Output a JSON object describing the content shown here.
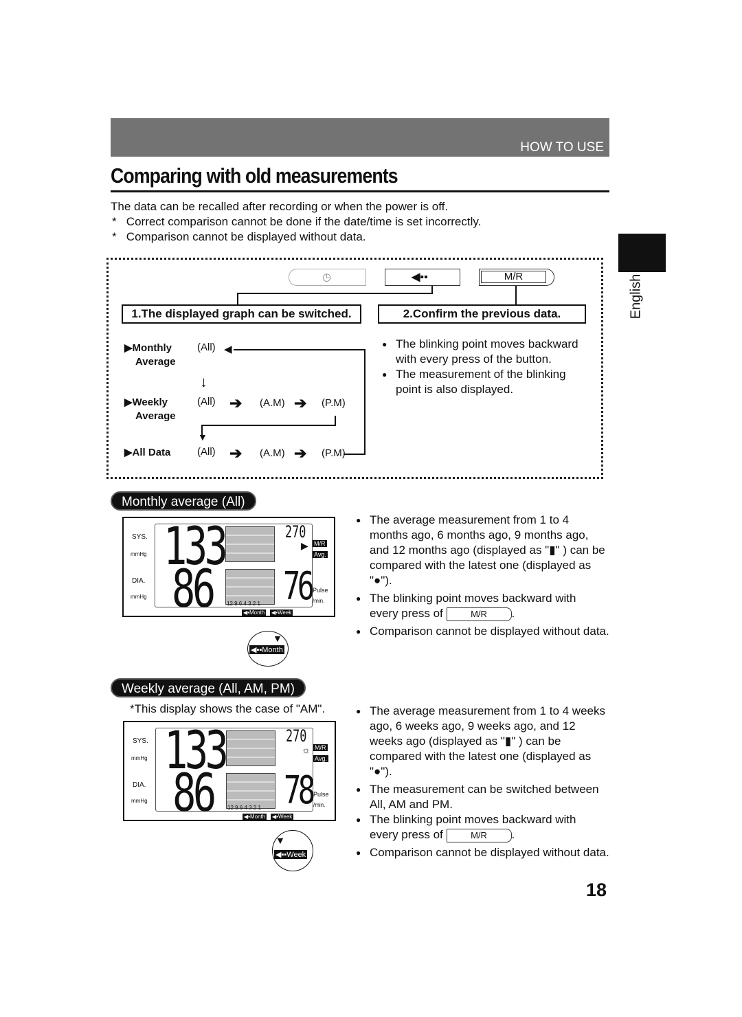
{
  "header": {
    "section": "HOW TO USE",
    "title": "Comparing with old measurements"
  },
  "intro": {
    "line": "The data can be recalled after recording or when the power is off.",
    "notes": [
      "Correct comparison cannot be done if the date/time is set incorrectly.",
      "Comparison cannot be displayed without data."
    ]
  },
  "side_tab": {
    "language": "English"
  },
  "diagram": {
    "buttons": {
      "mr": "M/R"
    },
    "box1": "1.The displayed graph can be switched.",
    "box2": "2.Confirm the previous data.",
    "rows": [
      {
        "label": "▶Monthly",
        "label2": "Average",
        "modes": [
          "(All)"
        ]
      },
      {
        "label": "▶Weekly",
        "label2": "Average",
        "modes": [
          "(All)",
          "(A.M)",
          "(P.M)"
        ]
      },
      {
        "label": "▶All Data",
        "label2": "",
        "modes": [
          "(All)",
          "(A.M)",
          "(P.M)"
        ]
      }
    ],
    "bullets": [
      "The blinking point moves backward with every press of the button.",
      "The measurement of the blinking point is also displayed."
    ]
  },
  "monthly": {
    "heading": "Monthly average (All)",
    "lcd": {
      "sys": "133",
      "dia": "86",
      "pulse": "76",
      "memory": "270",
      "sys_label": "SYS.",
      "dia_label": "DIA.",
      "unit": "mmHg",
      "pulse_label": "Pulse",
      "per_min": "/min.",
      "mr_tag": "M/R",
      "avg_tag": "Avg.",
      "axis": "12 9 6 4 3 2 1",
      "month_tag": "Month",
      "week_tag": "Week"
    },
    "zoom_label": "Month",
    "bullets": {
      "b1": "The average measurement from 1 to 4 months ago, 6 months ago, 9 months ago, and 12 months ago (displayed as \"▮\" ) can be compared with the latest one (displayed as \"●\").",
      "b2a": "The blinking point moves backward with",
      "b2b": "every press of",
      "b2c": ".",
      "b3": "Comparison cannot be displayed without data."
    }
  },
  "weekly": {
    "heading": "Weekly average (All, AM, PM)",
    "note": "*This display shows the case of \"AM\".",
    "lcd": {
      "sys": "133",
      "dia": "86",
      "pulse": "78",
      "memory": "270",
      "sys_label": "SYS.",
      "dia_label": "DIA.",
      "unit": "mmHg",
      "pulse_label": "Pulse",
      "per_min": "/min.",
      "mr_tag": "M/R",
      "avg_tag": "Avg.",
      "axis": "12 9 6 4 3 2 1",
      "month_tag": "Month",
      "week_tag": "Week"
    },
    "zoom_label": "Week",
    "bullets": {
      "b1": "The average measurement from 1 to 4 weeks ago, 6 weeks ago, 9 weeks ago, and 12 weeks ago (displayed as \"▮\" ) can be compared with the latest one (displayed as \"●\").",
      "b2": "The measurement can be switched between All, AM and PM.",
      "b3a": "The blinking point moves backward with",
      "b3b": "every press of",
      "b3c": ".",
      "b4": "Comparison cannot be displayed without data."
    }
  },
  "page_number": "18"
}
